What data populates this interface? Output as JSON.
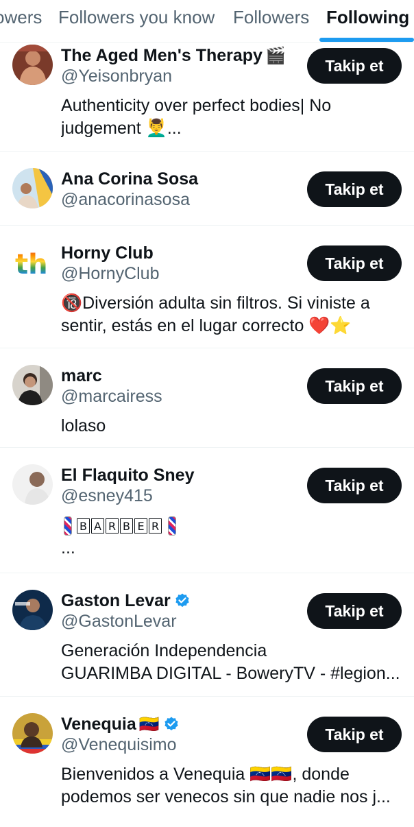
{
  "tabs": [
    {
      "label": "owers",
      "active": false
    },
    {
      "label": "Followers you know",
      "active": false
    },
    {
      "label": "Followers",
      "active": false
    },
    {
      "label": "Following",
      "active": true
    }
  ],
  "accent_color": "#1d9bf0",
  "follow_label": "Takip et",
  "users": [
    {
      "name": "The Aged Men's Therapy",
      "name_emoji": "🎬",
      "verified": false,
      "handle": "@Yeisonbryan",
      "bio": [
        "Authenticity over perfect bodies| No",
        "judgement 💆‍♂️..."
      ]
    },
    {
      "name": "Ana Corina Sosa",
      "name_emoji": "",
      "verified": false,
      "handle": "@anacorinasosa",
      "bio": []
    },
    {
      "name": "Horny Club",
      "name_emoji": "",
      "verified": false,
      "handle": "@HornyClub",
      "bio": [
        "🔞Diversión adulta sin filtros. Si viniste a",
        "sentir, estás en el lugar correcto ❤️⭐"
      ]
    },
    {
      "name": "marc",
      "name_emoji": "",
      "verified": false,
      "handle": "@marcairess",
      "bio": [
        "lolaso"
      ]
    },
    {
      "name": "El Flaquito Sney",
      "name_emoji": "",
      "verified": false,
      "handle": "@esney415",
      "bio_barber": [
        "B",
        "A",
        "R",
        "B",
        "E",
        "R"
      ],
      "bio": [
        "..."
      ]
    },
    {
      "name": "Gaston Levar",
      "name_emoji": "",
      "verified": true,
      "handle": "@GastonLevar",
      "bio": [
        "Generación Independencia",
        "GUARIMBA DIGITAL - BoweryTV - #legion..."
      ]
    },
    {
      "name": "Venequia",
      "name_emoji": "🇻🇪",
      "verified": true,
      "handle": "@Venequisimo",
      "bio": [
        "Bienvenidos a Venequia 🇻🇪🇻🇪, donde",
        "podemos ser venecos sin que nadie nos j..."
      ]
    }
  ]
}
